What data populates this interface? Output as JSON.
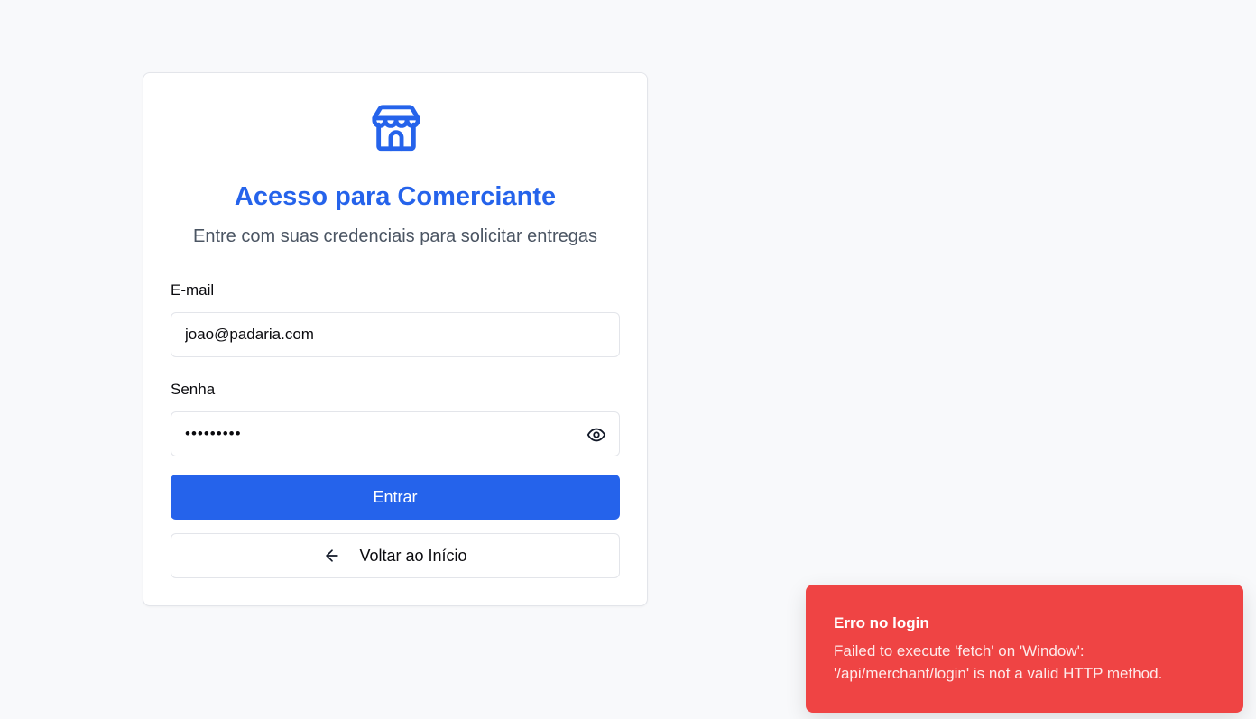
{
  "login": {
    "title": "Acesso para Comerciante",
    "subtitle": "Entre com suas credenciais para solicitar entregas",
    "logo_icon": "store-icon",
    "email": {
      "label": "E-mail",
      "value": "joao@padaria.com"
    },
    "password": {
      "label": "Senha",
      "value": "123456789",
      "toggle_icon": "eye-icon"
    },
    "submit_label": "Entrar",
    "back_label": "Voltar ao Início",
    "back_icon": "arrow-left-icon"
  },
  "toast": {
    "title": "Erro no login",
    "message": "Failed to execute 'fetch' on 'Window': '/api/merchant/login' is not a valid HTTP method."
  },
  "colors": {
    "primary": "#2563eb",
    "error": "#ef4444",
    "background": "#f8f9fb"
  }
}
